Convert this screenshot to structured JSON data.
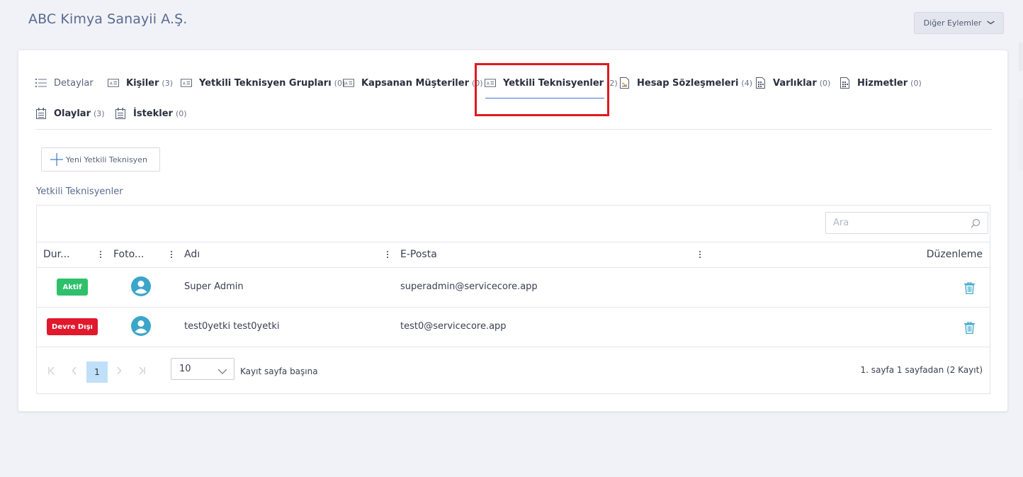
{
  "header": {
    "title": "ABC Kimya Sanayii A.Ş.",
    "more_actions": "Diğer Eylemler"
  },
  "tabs": [
    {
      "label": "Detaylar",
      "count": "",
      "icon": "list-icon"
    },
    {
      "label": "Kişiler",
      "count": "(3)",
      "icon": "contact-card-icon"
    },
    {
      "label": "Yetkili Teknisyen Grupları",
      "count": "(0)",
      "icon": "contact-card-icon"
    },
    {
      "label": "Kapsanan Müşteriler",
      "count": "(0)",
      "icon": "contact-card-icon"
    },
    {
      "label": "Yetkili Teknisyenler",
      "count": "(2)",
      "icon": "contact-card-icon",
      "active": true
    },
    {
      "label": "Hesap Sözleşmeleri",
      "count": "(4)",
      "icon": "contract-doc-icon"
    },
    {
      "label": "Varlıklar",
      "count": "(0)",
      "icon": "asset-doc-icon"
    },
    {
      "label": "Hizmetler",
      "count": "(0)",
      "icon": "service-doc-icon"
    },
    {
      "label": "Olaylar",
      "count": "(3)",
      "icon": "calendar-icon"
    },
    {
      "label": "İstekler",
      "count": "(0)",
      "icon": "calendar-icon"
    }
  ],
  "toolbar": {
    "new_button": "Yeni Yetkili Teknisyen"
  },
  "section_title": "Yetkili Teknisyenler",
  "grid": {
    "search_placeholder": "Ara",
    "columns": {
      "status": "Dur...",
      "photo": "Foto...",
      "name": "Adı",
      "email": "E-Posta",
      "edit": "Düzenleme"
    },
    "rows": [
      {
        "status": "Aktif",
        "status_color": "#2ec06b",
        "name": "Super Admin",
        "email": "superadmin@servicecore.app"
      },
      {
        "status": "Devre Dışı",
        "status_color": "#e0192c",
        "name": "test0yetki test0yetki",
        "email": "test0@servicecore.app"
      }
    ]
  },
  "pager": {
    "current_page": "1",
    "page_size": "10",
    "per_page_label": "Kayıt sayfa başına",
    "summary": "1. sayfa 1 sayfadan (2 Kayıt)"
  },
  "colors": {
    "accent": "#4a6fe0",
    "highlight_border": "#e0191f",
    "icon_teal": "#3aa6c9"
  }
}
